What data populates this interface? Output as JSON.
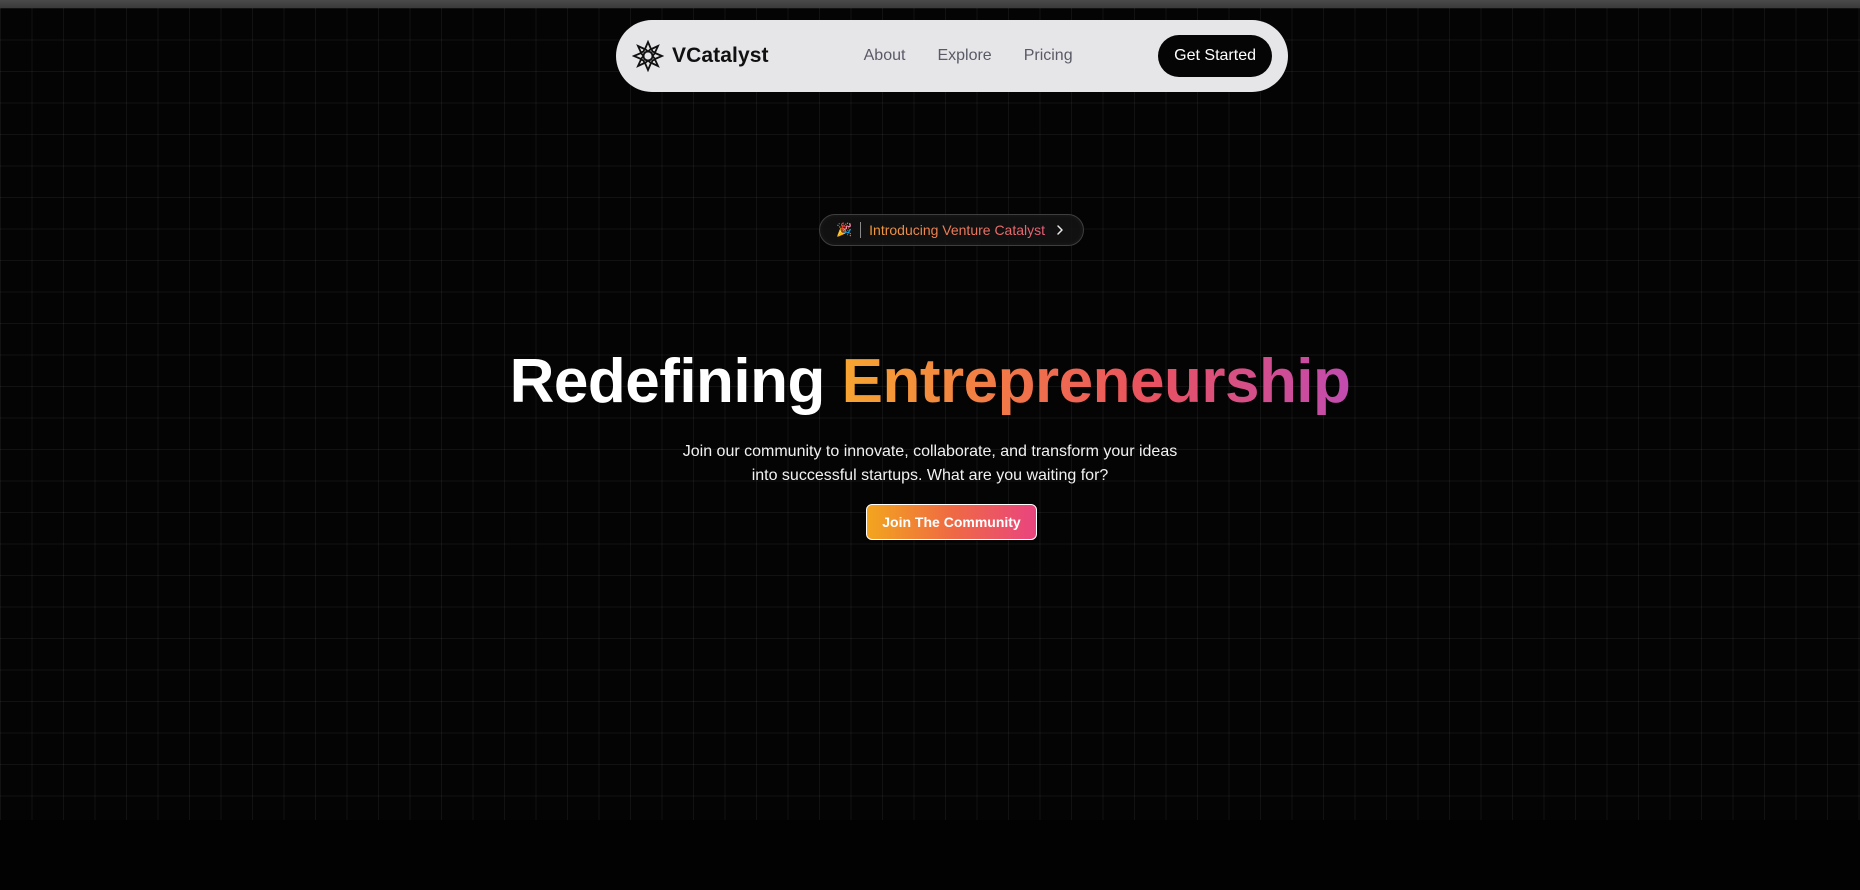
{
  "navbar": {
    "brand_name": "VCatalyst",
    "links": [
      "About",
      "Explore",
      "Pricing"
    ],
    "cta_label": "Get Started"
  },
  "announcement": {
    "emoji": "🎉",
    "text": "Introducing Venture Catalyst",
    "chevron_icon": "chevron-right-icon"
  },
  "hero": {
    "headline_plain": "Redefining ",
    "headline_highlight": "Entrepreneurship",
    "subtext": "Join our community to innovate, collaborate, and transform your ideas into successful startups. What are you waiting for?",
    "button_label": "Join The Community"
  },
  "colors": {
    "background": "#040404",
    "navbar_bg": "#e6e6e9",
    "gradient_start": "#f7a531",
    "gradient_mid": "#e9525f",
    "gradient_end": "#c14bb0"
  }
}
